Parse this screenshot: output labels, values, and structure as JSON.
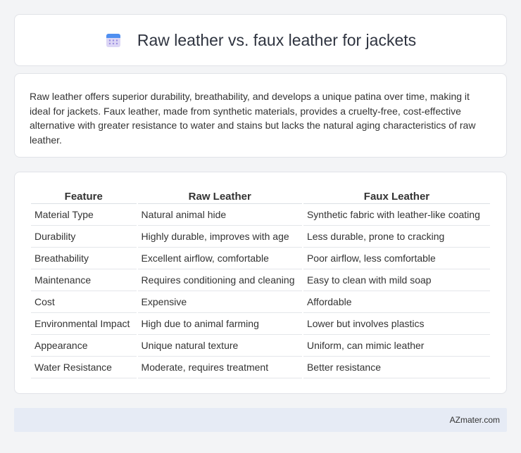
{
  "header": {
    "title": "Raw leather vs. faux leather for jackets",
    "icon": "calendar-icon"
  },
  "summary": {
    "text": "Raw leather offers superior durability, breathability, and develops a unique patina over time, making it ideal for jackets. Faux leather, made from synthetic materials, provides a cruelty-free, cost-effective alternative with greater resistance to water and stains but lacks the natural aging characteristics of raw leather."
  },
  "table": {
    "headers": [
      "Feature",
      "Raw Leather",
      "Faux Leather"
    ],
    "rows": [
      [
        "Material Type",
        "Natural animal hide",
        "Synthetic fabric with leather-like coating"
      ],
      [
        "Durability",
        "Highly durable, improves with age",
        "Less durable, prone to cracking"
      ],
      [
        "Breathability",
        "Excellent airflow, comfortable",
        "Poor airflow, less comfortable"
      ],
      [
        "Maintenance",
        "Requires conditioning and cleaning",
        "Easy to clean with mild soap"
      ],
      [
        "Cost",
        "Expensive",
        "Affordable"
      ],
      [
        "Environmental Impact",
        "High due to animal farming",
        "Lower but involves plastics"
      ],
      [
        "Appearance",
        "Unique natural texture",
        "Uniform, can mimic leather"
      ],
      [
        "Water Resistance",
        "Moderate, requires treatment",
        "Better resistance"
      ]
    ]
  },
  "footer": {
    "brand": "AZmater.com"
  }
}
